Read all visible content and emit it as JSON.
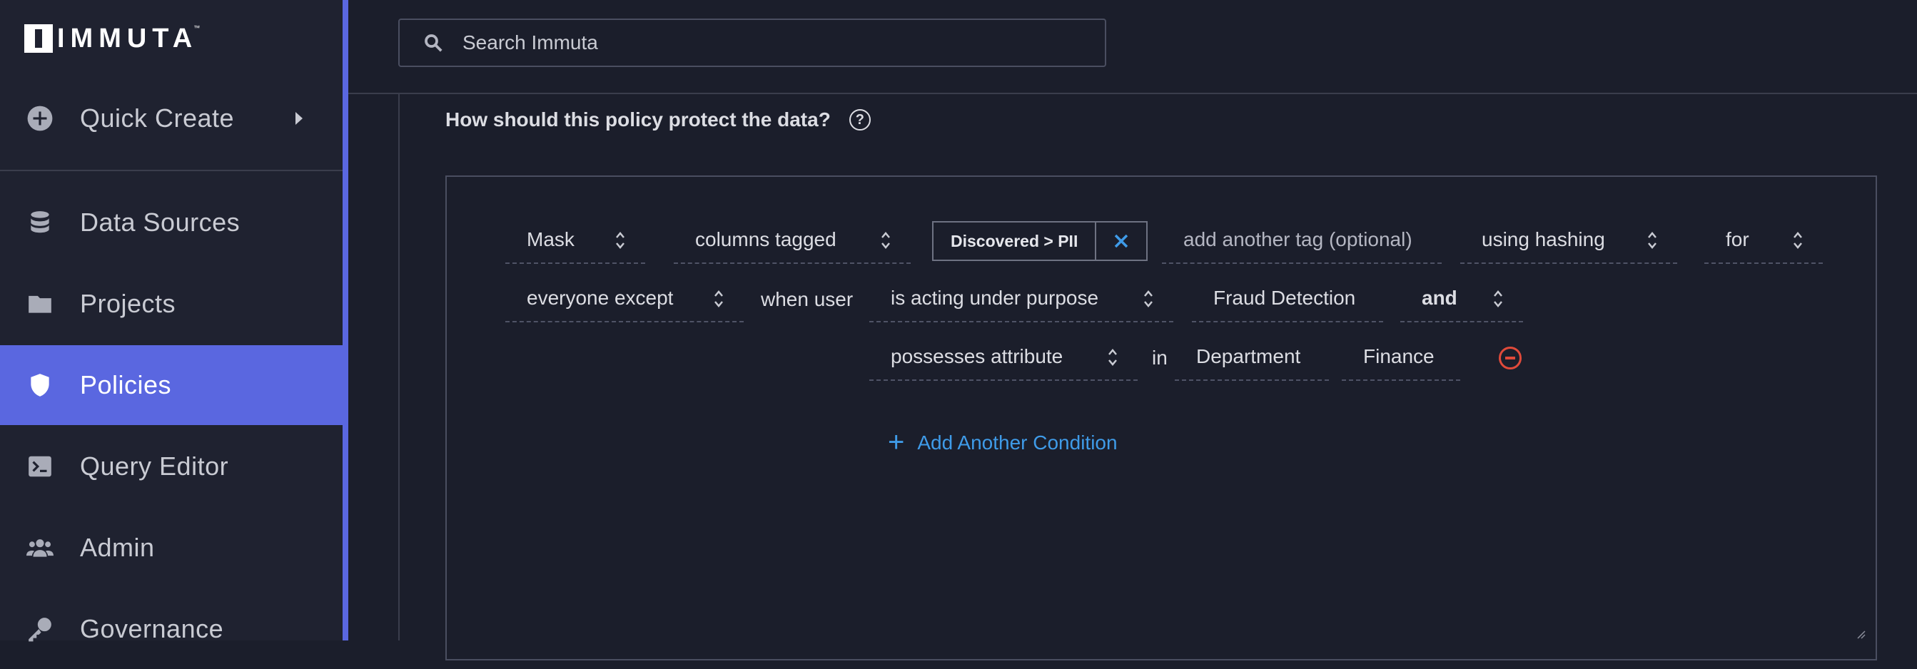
{
  "logo": {
    "text": "IMMUTA",
    "tm": "™"
  },
  "sidebar": {
    "items": [
      {
        "label": "Quick Create",
        "icon": "plus-circle-icon"
      },
      {
        "label": "Data Sources",
        "icon": "database-icon"
      },
      {
        "label": "Projects",
        "icon": "folder-icon"
      },
      {
        "label": "Policies",
        "icon": "shield-icon",
        "active": true
      },
      {
        "label": "Query Editor",
        "icon": "terminal-icon"
      },
      {
        "label": "Admin",
        "icon": "users-icon"
      },
      {
        "label": "Governance",
        "icon": "key-icon"
      }
    ]
  },
  "search": {
    "placeholder": "Search Immuta"
  },
  "policy": {
    "question": "How should this policy protect the data?",
    "help": "?",
    "row1": {
      "action": "Mask",
      "target": "columns tagged",
      "tag": "Discovered > PII",
      "add_tag_placeholder": "add another tag (optional)",
      "method": "using hashing",
      "for": "for"
    },
    "row2": {
      "who": "everyone except",
      "when_user": "when user",
      "condition1": "is acting under purpose",
      "purpose": "Fraud Detection",
      "conjunction": "and"
    },
    "row3": {
      "condition2": "possesses attribute",
      "in": "in",
      "attribute": "Department",
      "value": "Finance"
    },
    "add_condition": "Add Another Condition"
  },
  "colors": {
    "accent": "#5a67e0",
    "link": "#3f9be8",
    "danger": "#e04a3a"
  }
}
